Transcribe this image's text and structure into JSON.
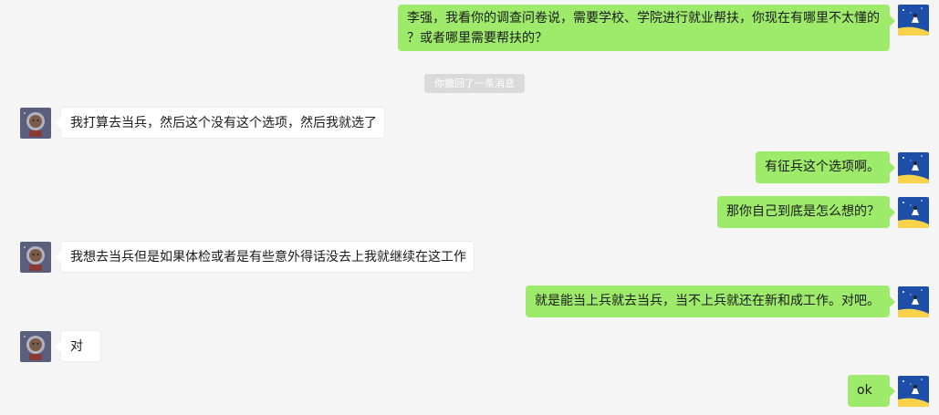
{
  "messages": [
    {
      "from": "me",
      "text": "李强，我看你的调查问卷说，需要学校、学院进行就业帮扶，你现在有哪里不太懂的？或者哪里需要帮扶的？"
    },
    {
      "from": "them",
      "text": "我打算去当兵，然后这个没有这个选项，然后我就选了"
    },
    {
      "from": "me",
      "text": "有征兵这个选项啊。"
    },
    {
      "from": "me",
      "text": "那你自己到底是怎么想的？"
    },
    {
      "from": "them",
      "text": "我想去当兵但是如果体检或者是有些意外得话没去上我就继续在这工作"
    },
    {
      "from": "me",
      "text": "就是能当上兵就去当兵，当不上兵就还在新和成工作。对吧。"
    },
    {
      "from": "them",
      "text": "对"
    },
    {
      "from": "me",
      "text": "ok"
    }
  ],
  "first_message_lines": [
    "李强，我看你的调查问卷说，需要学校、学院进行就业帮扶，你现在有哪里不太懂的",
    "？或者哪里需要帮扶的？"
  ],
  "system_note": "你撤回了一条消息",
  "colors": {
    "me_bubble": "#9eea6a",
    "them_bubble": "#ffffff",
    "background": "#f5f5f5",
    "system_note_bg": "#dadada"
  },
  "avatars": {
    "me": "night-sky-moon-avatar",
    "them": "astronaut-bear-avatar"
  }
}
